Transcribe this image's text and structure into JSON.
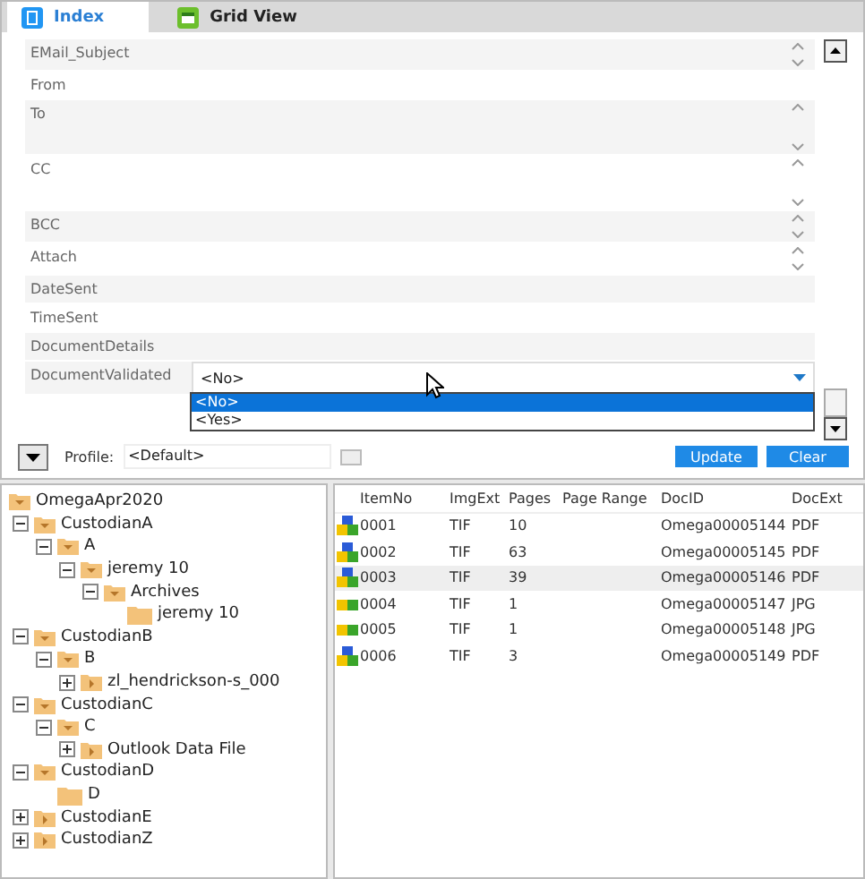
{
  "tabs": [
    {
      "label": "Index",
      "kind": "doc",
      "selected": true
    },
    {
      "label": "Grid View",
      "kind": "grid",
      "selected": false
    }
  ],
  "fields": [
    {
      "label": "EMail_Subject",
      "kind": "scroll"
    },
    {
      "label": "From",
      "kind": "text"
    },
    {
      "label": "To",
      "kind": "tall"
    },
    {
      "label": "CC",
      "kind": "tall"
    },
    {
      "label": "BCC",
      "kind": "scroll"
    },
    {
      "label": "Attach",
      "kind": "scroll"
    },
    {
      "label": "DateSent",
      "kind": "text"
    },
    {
      "label": "TimeSent",
      "kind": "text"
    },
    {
      "label": "DocumentDetails",
      "kind": "text"
    },
    {
      "label": "DocumentValidated",
      "kind": "combo",
      "value": "<No>",
      "options": [
        {
          "label": "<No>",
          "selected": true
        },
        {
          "label": "<Yes>",
          "selected": false
        }
      ]
    }
  ],
  "profile": {
    "label": "Profile:",
    "value": "<Default>"
  },
  "buttons": [
    "Update",
    "Clear"
  ],
  "tree": {
    "root": "OmegaApr2020",
    "items": [
      {
        "label": "CustodianA",
        "expanded": true,
        "children": [
          {
            "label": "A",
            "expanded": true,
            "children": [
              {
                "label": "jeremy 10",
                "expanded": true,
                "children": [
                  {
                    "label": "Archives",
                    "expanded": true,
                    "children": [
                      {
                        "label": "jeremy 10"
                      }
                    ]
                  }
                ]
              }
            ]
          }
        ]
      },
      {
        "label": "CustodianB",
        "expanded": true,
        "children": [
          {
            "label": "B",
            "expanded": true,
            "children": [
              {
                "label": "zl_hendrickson-s_000",
                "expanded": false
              }
            ]
          }
        ]
      },
      {
        "label": "CustodianC",
        "expanded": true,
        "children": [
          {
            "label": "C",
            "expanded": true,
            "children": [
              {
                "label": "Outlook Data File",
                "expanded": false
              }
            ]
          }
        ]
      },
      {
        "label": "CustodianD",
        "expanded": true,
        "children": [
          {
            "label": "D"
          }
        ]
      },
      {
        "label": "CustodianE",
        "expanded": false
      },
      {
        "label": "CustodianZ",
        "expanded": false
      }
    ]
  },
  "table": {
    "columns": [
      "ItemNo",
      "ImgExt",
      "Pages",
      "Page Range",
      "DocID",
      "DocExt"
    ],
    "rows": [
      {
        "kind": "doc",
        "selected": false,
        "cells": [
          "0001",
          "TIF",
          "10",
          "",
          "Omega00005144",
          "PDF"
        ]
      },
      {
        "kind": "doc",
        "selected": false,
        "cells": [
          "0002",
          "TIF",
          "63",
          "",
          "Omega00005145",
          "PDF"
        ]
      },
      {
        "kind": "doc",
        "selected": true,
        "cells": [
          "0003",
          "TIF",
          "39",
          "",
          "Omega00005146",
          "PDF"
        ]
      },
      {
        "kind": "image",
        "selected": false,
        "cells": [
          "0004",
          "TIF",
          "1",
          "",
          "Omega00005147",
          "JPG"
        ]
      },
      {
        "kind": "image",
        "selected": false,
        "cells": [
          "0005",
          "TIF",
          "1",
          "",
          "Omega00005148",
          "JPG"
        ]
      },
      {
        "kind": "doc",
        "selected": false,
        "cells": [
          "0006",
          "TIF",
          "3",
          "",
          "Omega00005149",
          "PDF"
        ]
      }
    ]
  }
}
